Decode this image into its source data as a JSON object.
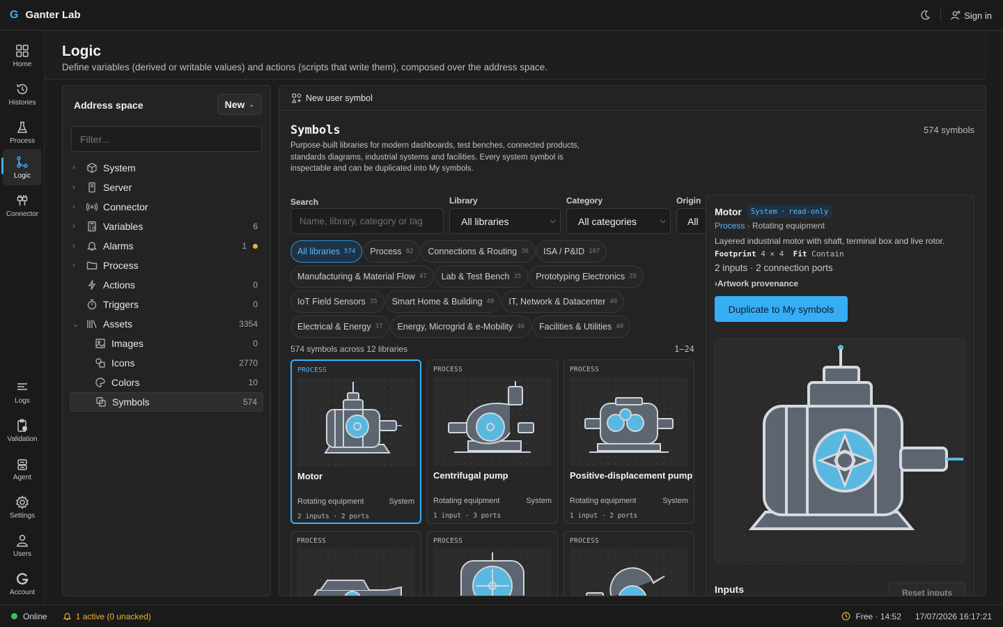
{
  "app": {
    "name": "Ganter Lab",
    "signin": "Sign in"
  },
  "rail": [
    {
      "label": "Home",
      "icon": "grid-icon"
    },
    {
      "label": "Histories",
      "icon": "history-icon"
    },
    {
      "label": "Process",
      "icon": "flask-icon"
    },
    {
      "label": "Logic",
      "icon": "logic-icon",
      "active": true
    },
    {
      "label": "Connector",
      "icon": "plug-icon"
    },
    {
      "label": "Logs",
      "icon": "lines-icon"
    },
    {
      "label": "Validation",
      "icon": "clipboard-check-icon"
    },
    {
      "label": "Agent",
      "icon": "bot-icon"
    },
    {
      "label": "Settings",
      "icon": "gear-icon"
    },
    {
      "label": "Users",
      "icon": "user-icon"
    },
    {
      "label": "Account",
      "icon": "g-logo-icon"
    }
  ],
  "page": {
    "title": "Logic",
    "subtitle": "Define variables (derived or writable values) and actions (scripts that write them), composed over the address space."
  },
  "address": {
    "title": "Address space",
    "new_label": "New",
    "filter_placeholder": "Filter...",
    "items": [
      {
        "label": "System",
        "count": ""
      },
      {
        "label": "Server",
        "count": ""
      },
      {
        "label": "Connector",
        "count": ""
      },
      {
        "label": "Variables",
        "count": "6"
      },
      {
        "label": "Alarms",
        "count": "1"
      },
      {
        "label": "Process",
        "count": ""
      },
      {
        "label": "Actions",
        "count": "0"
      },
      {
        "label": "Triggers",
        "count": "0"
      },
      {
        "label": "Assets",
        "count": "3354"
      },
      {
        "label": "Images",
        "count": "0"
      },
      {
        "label": "Icons",
        "count": "2770"
      },
      {
        "label": "Colors",
        "count": "10"
      },
      {
        "label": "Symbols",
        "count": "574"
      }
    ]
  },
  "symbols": {
    "top_button": "New user symbol",
    "title": "Symbols",
    "count": "574 symbols",
    "description": "Purpose-built libraries for modern dashboards, test benches, connected products, standards diagrams, industrial systems and facilities. Every system symbol is inspectable and can be duplicated into My symbols.",
    "search_label": "Search",
    "search_placeholder": "Name, library, category or tag",
    "library_label": "Library",
    "library_value": "All libraries",
    "category_label": "Category",
    "category_value": "All categories",
    "origin_label": "Origin",
    "origin_value": "All",
    "chips": [
      {
        "label": "All libraries",
        "n": "574",
        "active": true
      },
      {
        "label": "Process",
        "n": "82"
      },
      {
        "label": "Connections & Routing",
        "n": "36"
      },
      {
        "label": "ISA / P&ID",
        "n": "107"
      },
      {
        "label": "Manufacturing & Material Flow",
        "n": "47"
      },
      {
        "label": "Lab & Test Bench",
        "n": "35"
      },
      {
        "label": "Prototyping Electronics",
        "n": "35"
      },
      {
        "label": "IoT Field Sensors",
        "n": "35"
      },
      {
        "label": "Smart Home & Building",
        "n": "40"
      },
      {
        "label": "IT, Network & Datacenter",
        "n": "40"
      },
      {
        "label": "Electrical & Energy",
        "n": "37"
      },
      {
        "label": "Energy, Microgrid & e-Mobility",
        "n": "40"
      },
      {
        "label": "Facilities & Utilities",
        "n": "40"
      }
    ],
    "across": "574 symbols across 12 libraries",
    "range": "1–24",
    "cards": [
      {
        "cat": "PROCESS",
        "name": "Motor",
        "sub": "Rotating equipment",
        "origin": "System",
        "io": "2 inputs · 2 ports"
      },
      {
        "cat": "PROCESS",
        "name": "Centrifugal pump",
        "sub": "Rotating equipment",
        "origin": "System",
        "io": "1 input · 3 ports"
      },
      {
        "cat": "PROCESS",
        "name": "Positive-displacement pump",
        "sub": "Rotating equipment",
        "origin": "System",
        "io": "1 input · 2 ports"
      },
      {
        "cat": "PROCESS"
      },
      {
        "cat": "PROCESS"
      },
      {
        "cat": "PROCESS"
      }
    ]
  },
  "detail": {
    "name": "Motor",
    "badge_a": "System",
    "badge_b": "read-only",
    "category": "Process",
    "subcategory": "Rotating equipment",
    "description": "Layered industrial motor with shaft, terminal box and live rotor.",
    "footprint_label": "Footprint",
    "footprint": "4 × 4",
    "fit_label": "Fit",
    "fit": "Contain",
    "io": "2 inputs · 2 connection ports",
    "provenance": "Artwork provenance",
    "duplicate": "Duplicate to My symbols",
    "inputs_title": "Inputs",
    "reset": "Reset inputs"
  },
  "status": {
    "online": "Online",
    "alarm": "1 active (0 unacked)",
    "free": "Free · 14:52",
    "datetime": "17/07/2026 16:17:21"
  },
  "colors": {
    "accent": "#3bb0ff",
    "online": "#3cc15b",
    "alarm": "#e8b530",
    "rotor": "#5ab8e0"
  }
}
